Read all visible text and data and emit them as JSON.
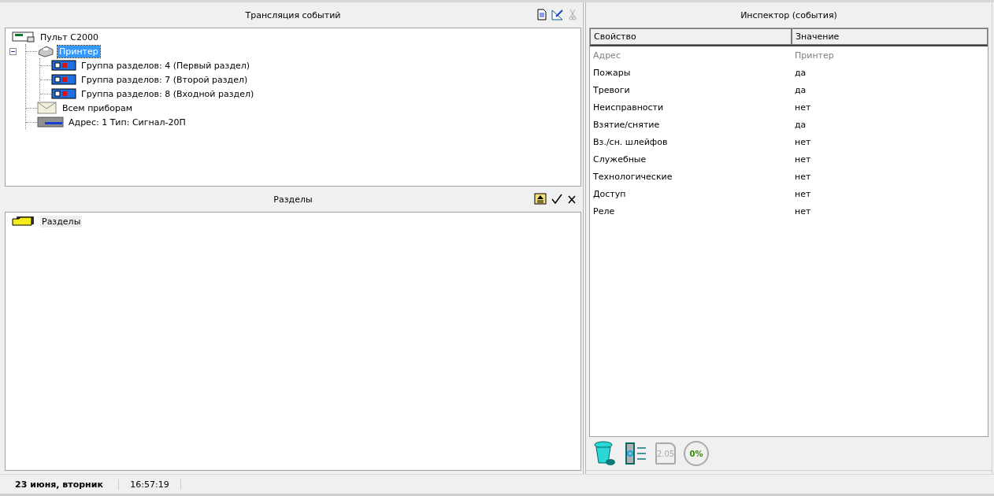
{
  "events_panel": {
    "title": "Трансляция событий",
    "tree": [
      {
        "label": "Пульт С2000",
        "kind": "console",
        "selected": false,
        "children": [
          {
            "label": "Принтер",
            "kind": "printer",
            "selected": true,
            "expanded": true,
            "children": [
              {
                "label": "Группа разделов: 4 (Первый раздел)",
                "kind": "group",
                "selected": false
              },
              {
                "label": "Группа разделов: 7 (Второй раздел)",
                "kind": "group",
                "selected": false
              },
              {
                "label": "Группа разделов: 8 (Входной раздел)",
                "kind": "group",
                "selected": false
              }
            ]
          },
          {
            "label": "Всем приборам",
            "kind": "mail",
            "selected": false
          },
          {
            "label": "Адрес: 1 Тип: Сигнал-20П",
            "kind": "device",
            "selected": false
          }
        ]
      }
    ]
  },
  "sections_panel": {
    "title": "Разделы",
    "items": [
      {
        "label": "Разделы",
        "selected": false
      }
    ]
  },
  "inspector": {
    "title": "Инспектор (события)",
    "columns": [
      "Свойство",
      "Значение"
    ],
    "rows": [
      {
        "property": "Адрес",
        "value": "Принтер",
        "disabled": true
      },
      {
        "property": "Пожары",
        "value": "да",
        "disabled": false
      },
      {
        "property": "Тревоги",
        "value": "да",
        "disabled": false
      },
      {
        "property": "Неисправности",
        "value": "нет",
        "disabled": false
      },
      {
        "property": "Взятие/снятие",
        "value": "да",
        "disabled": false
      },
      {
        "property": "Вз./сн. шлейфов",
        "value": "нет",
        "disabled": false
      },
      {
        "property": "Служебные",
        "value": "нет",
        "disabled": false
      },
      {
        "property": "Технологические",
        "value": "нет",
        "disabled": false
      },
      {
        "property": "Доступ",
        "value": "нет",
        "disabled": false
      },
      {
        "property": "Реле",
        "value": "нет",
        "disabled": false
      }
    ],
    "version_badge": "2.05",
    "progress_label": "0%"
  },
  "status_bar": {
    "date": "23 июня, вторник",
    "time": "16:57:19"
  }
}
